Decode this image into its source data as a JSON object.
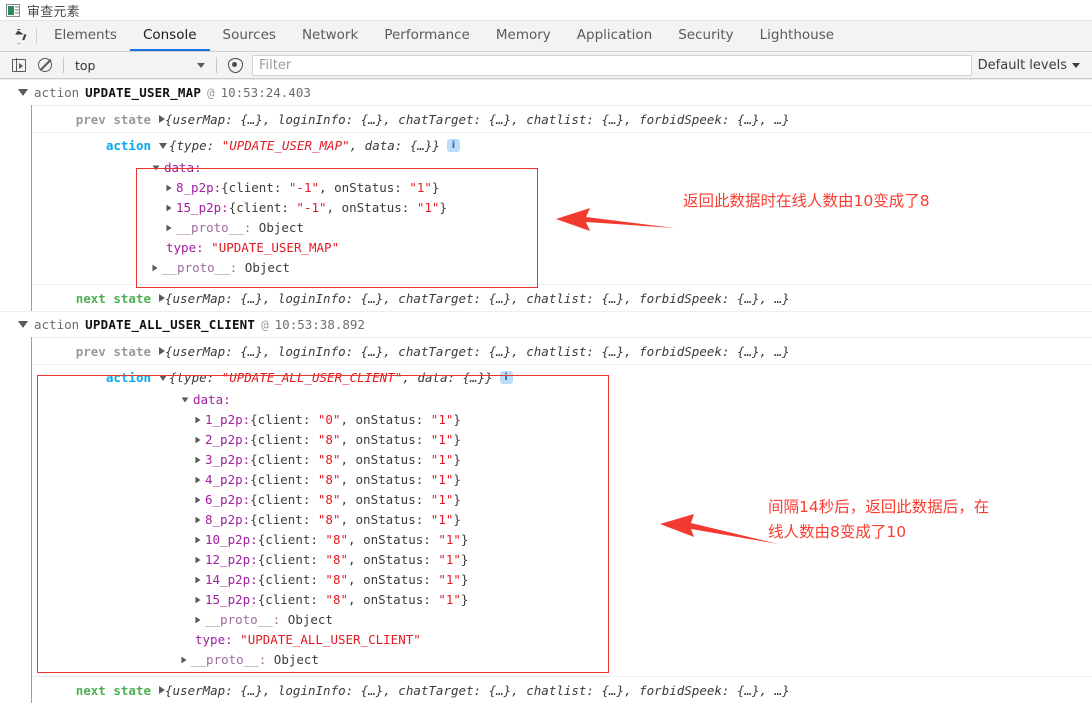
{
  "window": {
    "title": "审查元素",
    "icon": "devtools-window-icon"
  },
  "tabstrip": {
    "inspect_icon": "inspect-element-icon",
    "tabs": [
      {
        "label": "Elements",
        "active": false
      },
      {
        "label": "Console",
        "active": true
      },
      {
        "label": "Sources",
        "active": false
      },
      {
        "label": "Network",
        "active": false
      },
      {
        "label": "Performance",
        "active": false
      },
      {
        "label": "Memory",
        "active": false
      },
      {
        "label": "Application",
        "active": false
      },
      {
        "label": "Security",
        "active": false
      },
      {
        "label": "Lighthouse",
        "active": false
      }
    ]
  },
  "toolbar": {
    "sidebar_icon": "console-sidebar-icon",
    "clear_icon": "clear-console-icon",
    "context_value": "top",
    "eye_icon": "live-expression-icon",
    "filter_placeholder": "Filter",
    "filter_value": "",
    "levels_label": "Default levels"
  },
  "console": {
    "state_preview": "{userMap: {…}, loginInfo: {…}, chatTarget: {…}, chatlist: {…}, forbidSpeek: {…}, …}",
    "labels": {
      "prev": "prev state",
      "next": "next state",
      "action": "action"
    },
    "proto_label": "__proto__:",
    "proto_value": "Object",
    "type_key": "type:",
    "data_key": "data:",
    "groups": [
      {
        "prefix": "action",
        "type": "UPDATE_USER_MAP",
        "at": "@",
        "time": "10:53:24.403",
        "action_preview_open": "{type: ",
        "action_preview_type": "\"UPDATE_USER_MAP\"",
        "action_preview_close": ", data: {…}}",
        "type_value": "\"UPDATE_USER_MAP\"",
        "entries": [
          {
            "key": "8_p2p:",
            "client": "\"-1\"",
            "onStatus": "\"1\""
          },
          {
            "key": "15_p2p:",
            "client": "\"-1\"",
            "onStatus": "\"1\""
          }
        ]
      },
      {
        "prefix": "action",
        "type": "UPDATE_ALL_USER_CLIENT",
        "at": "@",
        "time": "10:53:38.892",
        "action_preview_open": "{type: ",
        "action_preview_type": "\"UPDATE_ALL_USER_CLIENT\"",
        "action_preview_close": ", data: {…}}",
        "type_value": "\"UPDATE_ALL_USER_CLIENT\"",
        "entries": [
          {
            "key": "1_p2p:",
            "client": "\"0\"",
            "onStatus": "\"1\""
          },
          {
            "key": "2_p2p:",
            "client": "\"8\"",
            "onStatus": "\"1\""
          },
          {
            "key": "3_p2p:",
            "client": "\"8\"",
            "onStatus": "\"1\""
          },
          {
            "key": "4_p2p:",
            "client": "\"8\"",
            "onStatus": "\"1\""
          },
          {
            "key": "6_p2p:",
            "client": "\"8\"",
            "onStatus": "\"1\""
          },
          {
            "key": "8_p2p:",
            "client": "\"8\"",
            "onStatus": "\"1\""
          },
          {
            "key": "10_p2p:",
            "client": "\"8\"",
            "onStatus": "\"1\""
          },
          {
            "key": "12_p2p:",
            "client": "\"8\"",
            "onStatus": "\"1\""
          },
          {
            "key": "14_p2p:",
            "client": "\"8\"",
            "onStatus": "\"1\""
          },
          {
            "key": "15_p2p:",
            "client": "\"8\"",
            "onStatus": "\"1\""
          }
        ]
      }
    ],
    "prop_client_label": "{client: ",
    "prop_onstatus_label": "onStatus: ",
    "prop_comma": ", ",
    "prop_close": "}"
  },
  "annotations": [
    {
      "text": "返回此数据时在线人数由10变成了8",
      "color": "#fb3b30"
    },
    {
      "text": "间隔14秒后，返回此数据后，在\n线人数由8变成了10",
      "color": "#fb3b30"
    }
  ],
  "colors": {
    "accent_tab": "#1a73e8",
    "annotation_red": "#fb3b30",
    "box_red": "#e8352b",
    "string_red": "#e01b24",
    "key_purple": "#a020a0",
    "action_blue": "#03A9F4",
    "next_green": "#4CAF50"
  }
}
